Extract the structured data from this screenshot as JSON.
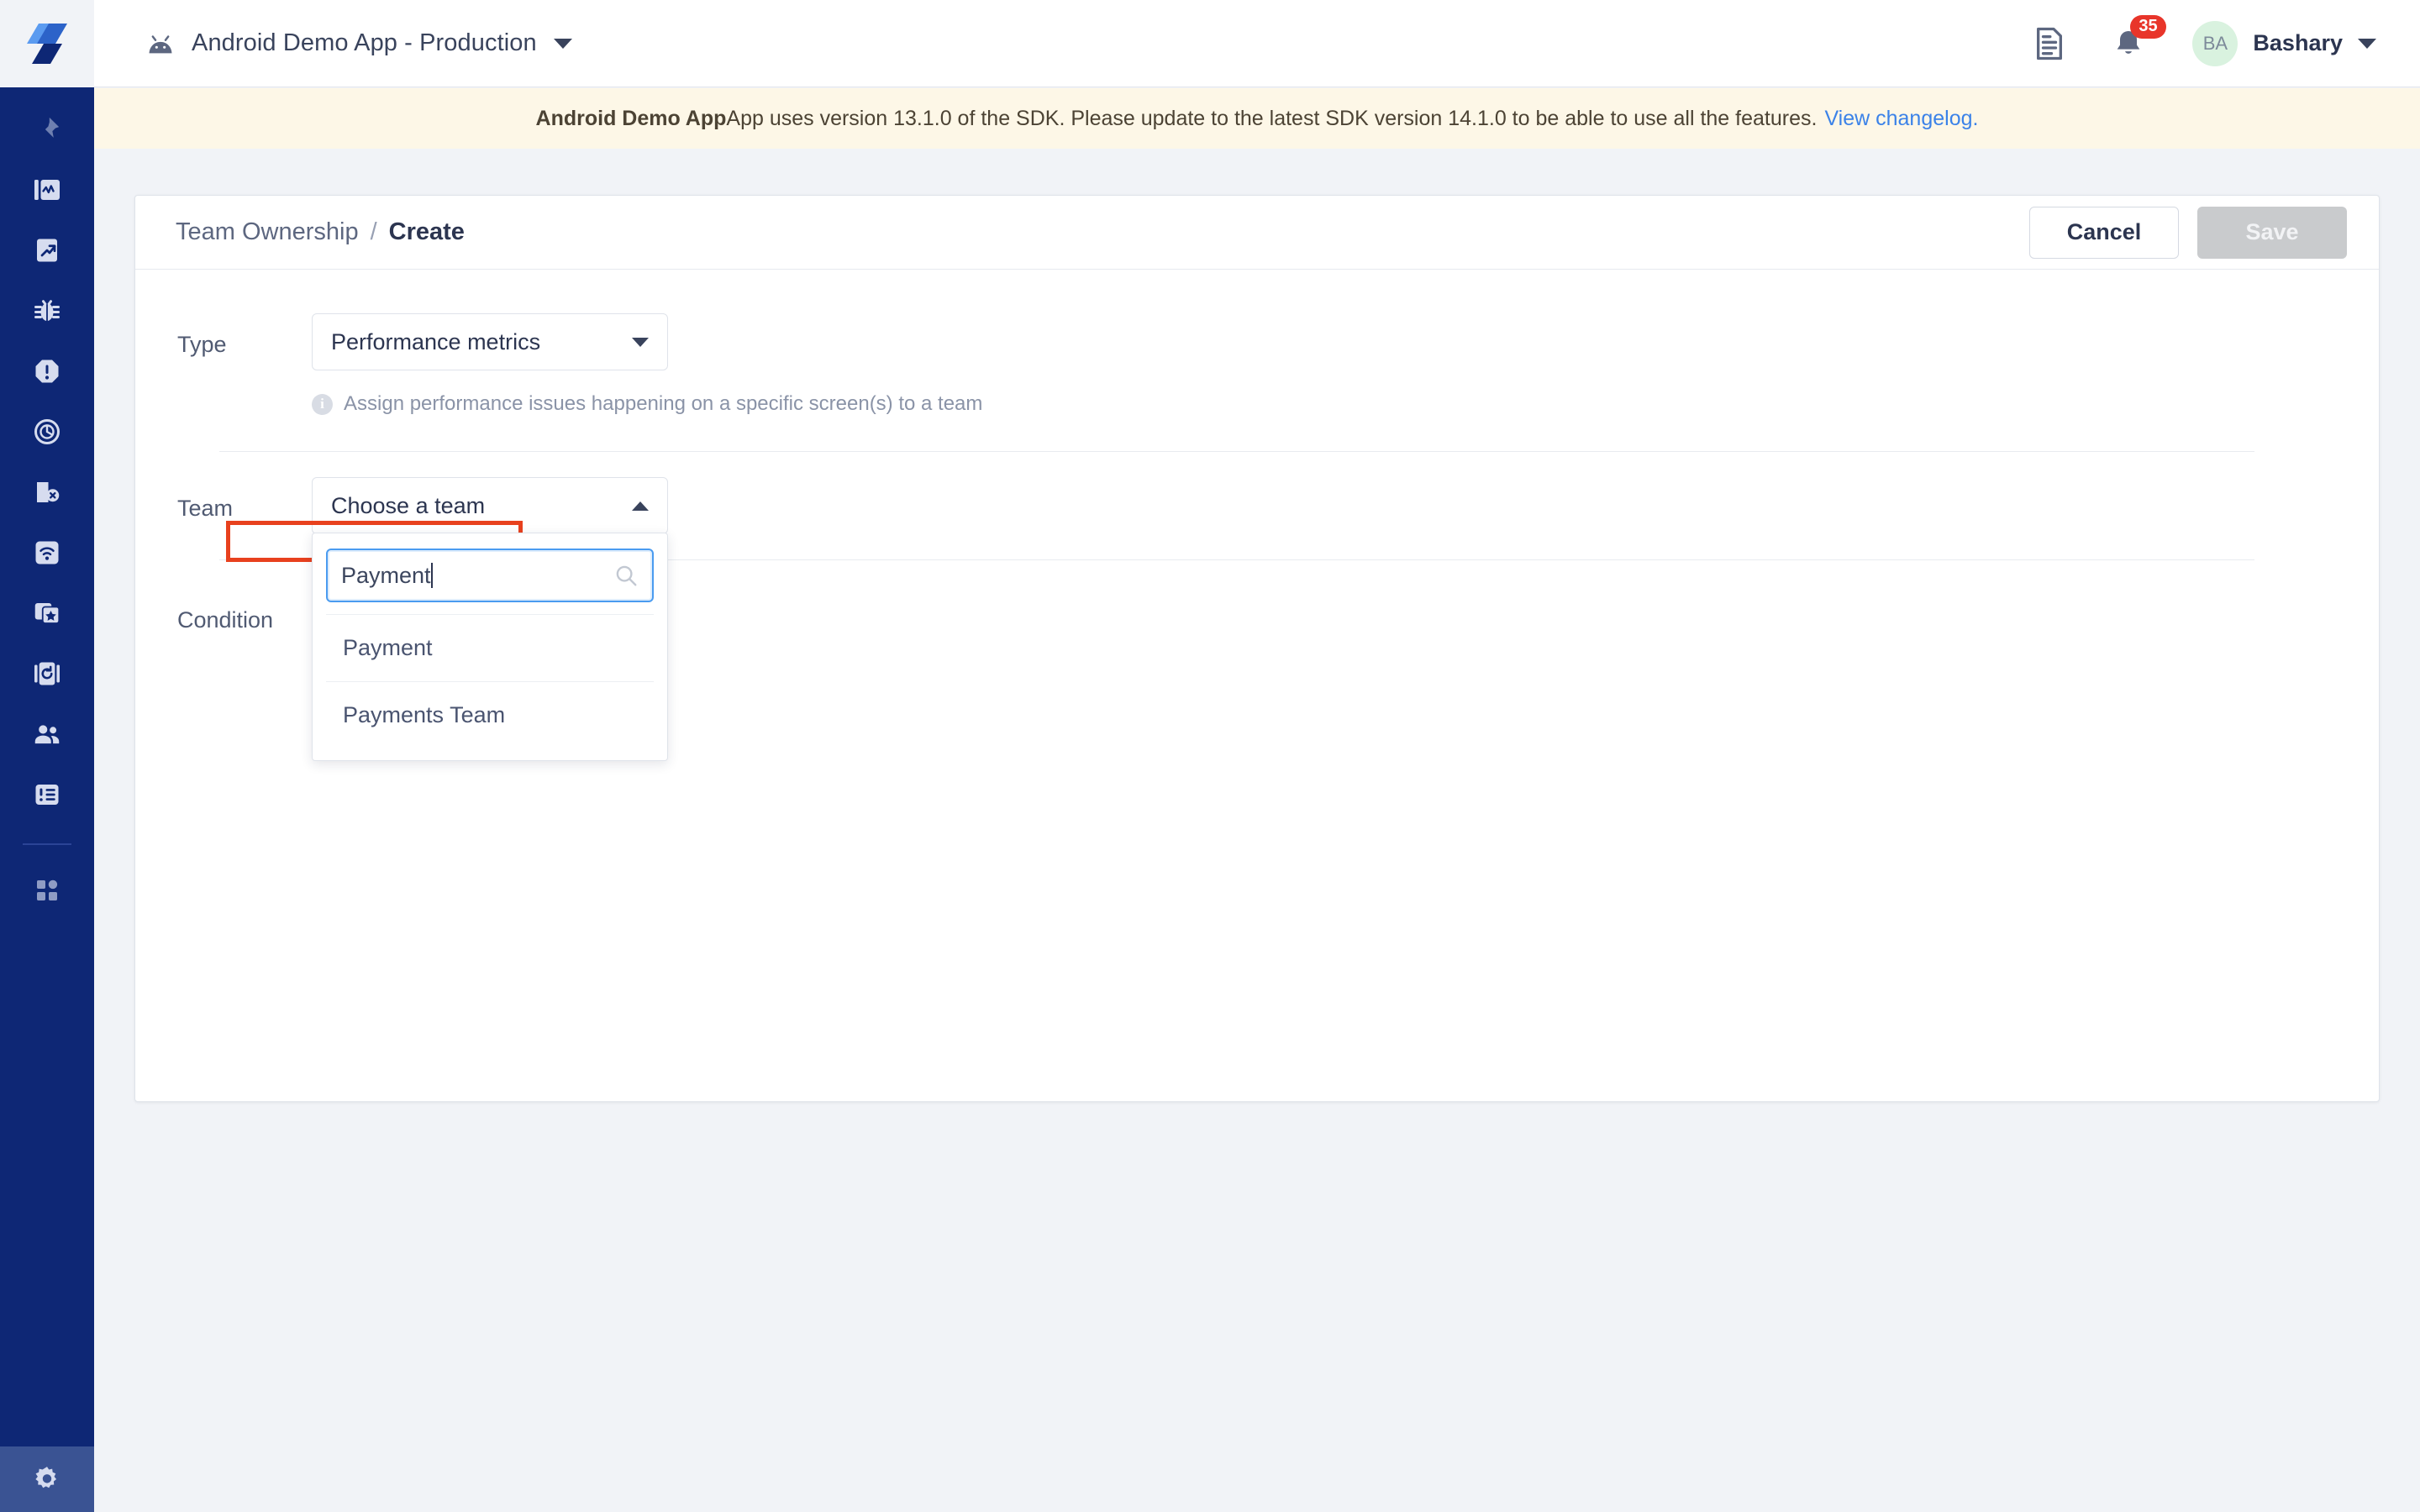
{
  "sidebar": {
    "logo": "instabug-logo",
    "items": [
      {
        "name": "pin-icon",
        "label": "Pin"
      },
      {
        "name": "app-performance-icon",
        "label": "App Performance"
      },
      {
        "name": "launch-report-icon",
        "label": "Launches"
      },
      {
        "name": "bug-icon",
        "label": "Bugs"
      },
      {
        "name": "crash-icon",
        "label": "Crashes"
      },
      {
        "name": "anr-icon",
        "label": "ANR"
      },
      {
        "name": "session-error-icon",
        "label": "Session Errors"
      },
      {
        "name": "network-icon",
        "label": "Network"
      },
      {
        "name": "app-rating-icon",
        "label": "App Rating"
      },
      {
        "name": "session-replay-icon",
        "label": "Session Replay"
      },
      {
        "name": "users-icon",
        "label": "Users"
      },
      {
        "name": "surveys-icon",
        "label": "Surveys"
      },
      {
        "name": "apps-grid-icon",
        "label": "All Apps"
      }
    ],
    "footer_item": {
      "name": "gear-icon",
      "label": "Settings"
    }
  },
  "topbar": {
    "app_icon": "android-icon",
    "app_title": "Android Demo App - Production",
    "app_caret": "chevron-down-icon",
    "docs_icon": "document-icon",
    "bell_icon": "bell-icon",
    "bell_count": "35",
    "avatar_initials": "BA",
    "user_name": "Bashary",
    "user_caret": "chevron-down-icon"
  },
  "banner": {
    "text_bold": "Android Demo App",
    "text_rest": " App uses version 13.1.0 of the SDK. Please update to the latest SDK version 14.1.0 to be able to use all the features.",
    "link": "View changelog.",
    "background": "#fdf7e7",
    "link_color": "#3b82e8"
  },
  "card": {
    "breadcrumb": {
      "root": "Team Ownership",
      "separator": "/",
      "current": "Create"
    },
    "cancel_label": "Cancel",
    "save_label": "Save",
    "save_disabled": true
  },
  "form": {
    "type": {
      "label": "Type",
      "value": "Performance metrics",
      "caret": "chevron-down-icon",
      "hint_icon": "info-icon",
      "hint": "Assign performance issues happening on a specific screen(s) to a team"
    },
    "team": {
      "label": "Team",
      "value": "Choose a team",
      "caret": "chevron-up-icon",
      "open": true,
      "search": {
        "value": "Payment",
        "placeholder": "",
        "icon": "search-icon"
      },
      "options": [
        {
          "label": "Payment",
          "highlighted": true
        },
        {
          "label": "Payments Team",
          "highlighted": false
        }
      ]
    },
    "condition": {
      "label": "Condition"
    }
  },
  "annotations": {
    "accent_color": "#e8411e",
    "boxes": [
      {
        "name": "team-row-highlight",
        "target": "team-row"
      },
      {
        "name": "payment-option-highlight",
        "target": "dropdown-option-payment"
      }
    ]
  }
}
